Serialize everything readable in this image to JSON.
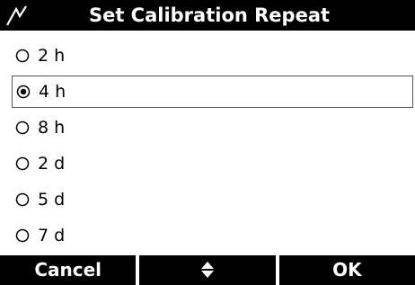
{
  "header": {
    "title": "Set Calibration Repeat",
    "icon": "calibration-icon"
  },
  "options": [
    {
      "label": "2 h",
      "selected": false
    },
    {
      "label": "4 h",
      "selected": true
    },
    {
      "label": "8 h",
      "selected": false
    },
    {
      "label": "2 d",
      "selected": false
    },
    {
      "label": "5 d",
      "selected": false
    },
    {
      "label": "7 d",
      "selected": false
    }
  ],
  "footer": {
    "cancel_label": "Cancel",
    "nav_icon": "up-down-arrows-icon",
    "ok_label": "OK"
  },
  "colors": {
    "bar_background": "#000000",
    "bar_text": "#ffffff",
    "screen_background": "#ffffff"
  }
}
